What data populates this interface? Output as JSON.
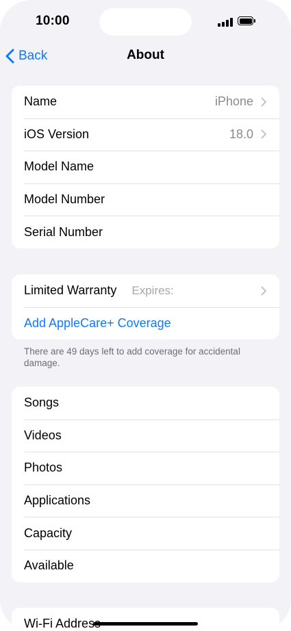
{
  "status_bar": {
    "time": "10:00"
  },
  "nav": {
    "back_label": "Back",
    "title": "About"
  },
  "device_group": {
    "rows": [
      {
        "label": "Name",
        "value": "iPhone"
      },
      {
        "label": "iOS Version",
        "value": "18.0"
      },
      {
        "label": "Model Name",
        "value": ""
      },
      {
        "label": "Model Number",
        "value": ""
      },
      {
        "label": "Serial Number",
        "value": ""
      }
    ]
  },
  "warranty_group": {
    "warranty_label": "Limited Warranty",
    "warranty_value": "Expires:",
    "applecare_label": "Add AppleCare+ Coverage",
    "footnote": "There are 49 days left to add coverage for accidental damage."
  },
  "media_group": {
    "rows": [
      {
        "label": "Songs"
      },
      {
        "label": "Videos"
      },
      {
        "label": "Photos"
      },
      {
        "label": "Applications"
      },
      {
        "label": "Capacity"
      },
      {
        "label": "Available"
      }
    ]
  },
  "network_group": {
    "rows": [
      {
        "label": "Wi-Fi Address"
      }
    ]
  },
  "colors": {
    "accent": "#0a7aff",
    "background": "#f2f2f7",
    "secondary_text": "#8a8a8e"
  },
  "icons": [
    "chevron-left-icon",
    "chevron-right-icon",
    "signal-icon",
    "battery-icon"
  ]
}
